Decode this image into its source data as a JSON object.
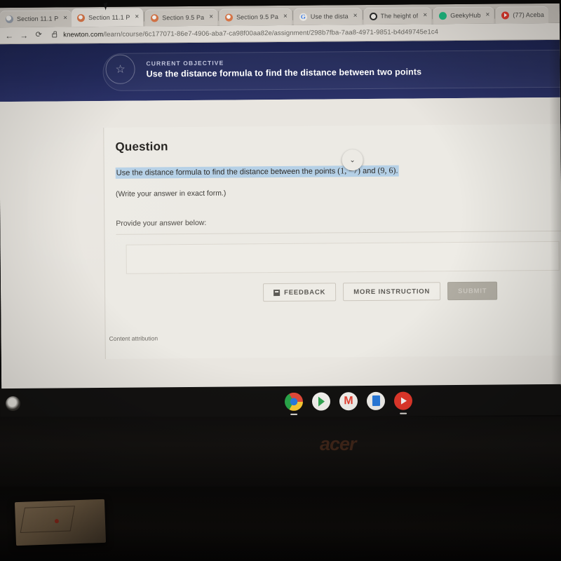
{
  "browser": {
    "tabs": [
      {
        "label": "Section 11.1 P",
        "favicon": "knewton-favicon",
        "close": "×",
        "active": false
      },
      {
        "label": "Section 11.1 P",
        "favicon": "knewton-alt-favicon",
        "close": "×",
        "active": true
      },
      {
        "label": "Section 9.5 Pa",
        "favicon": "knewton-alt-favicon",
        "close": "×",
        "active": false
      },
      {
        "label": "Section 9.5 Pa",
        "favicon": "knewton-alt-favicon",
        "close": "×",
        "active": false
      },
      {
        "label": "Use the dista",
        "favicon": "google-favicon",
        "close": "×",
        "active": false
      },
      {
        "label": "The height of",
        "favicon": "brainly-favicon",
        "close": "×",
        "active": false
      },
      {
        "label": "GeekyHub",
        "favicon": "geekyhub-favicon",
        "close": "×",
        "active": false
      },
      {
        "label": "(77) Aceba",
        "favicon": "youtube-favicon",
        "close": "×",
        "active": false
      }
    ],
    "nav": {
      "back": "←",
      "forward": "→",
      "reload": "⟳"
    },
    "omnibox": {
      "lock_icon": "lock-icon",
      "host": "knewton.com",
      "path": "/learn/course/6c177071-86e7-4906-aba7-ca98f00aa82e/assignment/298b7fba-7aa8-4971-9851-b4d49745e1c4"
    }
  },
  "objective": {
    "badge_icon": "star-in-circle-icon",
    "kicker": "CURRENT OBJECTIVE",
    "title": "Use the distance formula to find the distance between two points",
    "collapse_icon": "⌄"
  },
  "question": {
    "heading": "Question",
    "prompt_prefix": "Use the distance formula to find the distance between the points ",
    "point_a": "(1, −7)",
    "conjunction": " and ",
    "point_b": "(9, 6)",
    "period": ".",
    "note": "(Write your answer in exact form.)",
    "answer_label": "Provide your answer below:",
    "answer_value": "",
    "answer_placeholder": "",
    "attribution": "Content attribution"
  },
  "actions": {
    "feedback_icon": "flag-icon",
    "feedback": "FEEDBACK",
    "more_instruction": "MORE INSTRUCTION",
    "submit": "SUBMIT"
  },
  "shelf": {
    "launcher_icon": "launcher-circle-icon",
    "apps": [
      {
        "name": "chrome-icon",
        "label": ""
      },
      {
        "name": "play-store-icon",
        "label": ""
      },
      {
        "name": "gmail-icon",
        "label": "M"
      },
      {
        "name": "google-docs-icon",
        "label": ""
      },
      {
        "name": "youtube-icon",
        "label": ""
      }
    ]
  },
  "device": {
    "brand": "acer"
  },
  "colors": {
    "banner_blue": "#232a5c",
    "selection_blue": "#b5d0e6",
    "page_bg": "#e9e6e0",
    "card_bg": "#eceae4",
    "submit_disabled": "#b2aea4"
  }
}
